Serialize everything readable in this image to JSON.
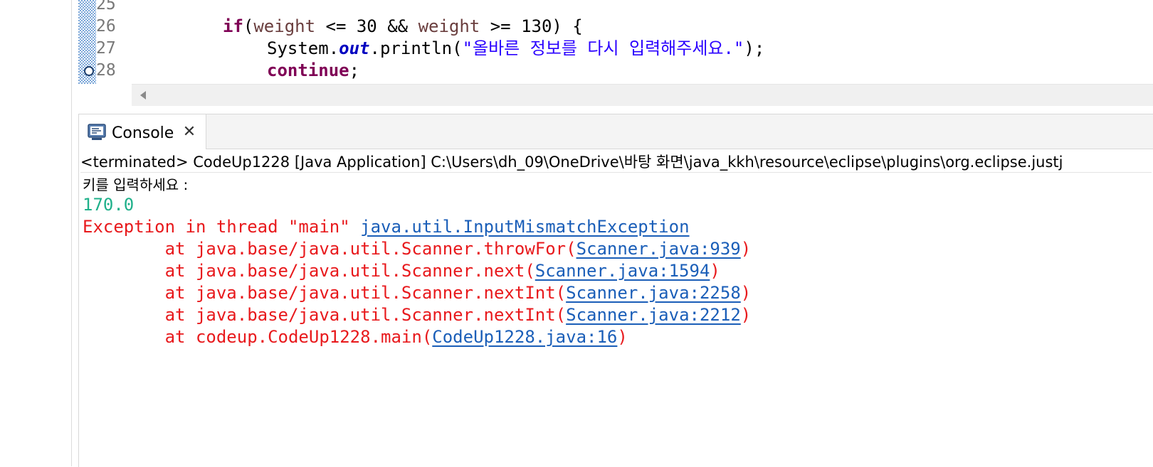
{
  "editor": {
    "lines": [
      {
        "num": "25"
      },
      {
        "num": "26",
        "t1": "if",
        "t2": "(",
        "t3": "weight",
        "t4": " <= 30 && ",
        "t5": "weight",
        "t6": " >= 130) {"
      },
      {
        "num": "27",
        "t1": "System.",
        "t2": "out",
        "t3": ".println(",
        "t4": "\"올바른 정보를 다시 입력해주세요.\"",
        "t5": ");"
      },
      {
        "num": "28",
        "t1": "continue",
        "t2": ";"
      }
    ]
  },
  "console": {
    "tab_label": "Console",
    "close_glyph": "✕",
    "status": "<terminated> CodeUp1228 [Java Application] C:\\Users\\dh_09\\OneDrive\\바탕 화면\\java_kkh\\resource\\eclipse\\plugins\\org.eclipse.justj",
    "prompt": "키를 입력하세요 :",
    "input_echo": "170.0",
    "exception_prefix": "Exception in thread \"main\" ",
    "exception_link": "java.util.InputMismatchException",
    "stack": [
      {
        "text": "        at java.base/java.util.Scanner.throwFor(",
        "link": "Scanner.java:939",
        "end": ")"
      },
      {
        "text": "        at java.base/java.util.Scanner.next(",
        "link": "Scanner.java:1594",
        "end": ")"
      },
      {
        "text": "        at java.base/java.util.Scanner.nextInt(",
        "link": "Scanner.java:2258",
        "end": ")"
      },
      {
        "text": "        at java.base/java.util.Scanner.nextInt(",
        "link": "Scanner.java:2212",
        "end": ")"
      },
      {
        "text": "        at codeup.CodeUp1228.main(",
        "link": "CodeUp1228.java:16",
        "end": ")"
      }
    ]
  },
  "colors": {
    "error": "#e8191c",
    "link": "#1a5eb8",
    "input": "#1fb08a",
    "keyword": "#7f0055"
  }
}
